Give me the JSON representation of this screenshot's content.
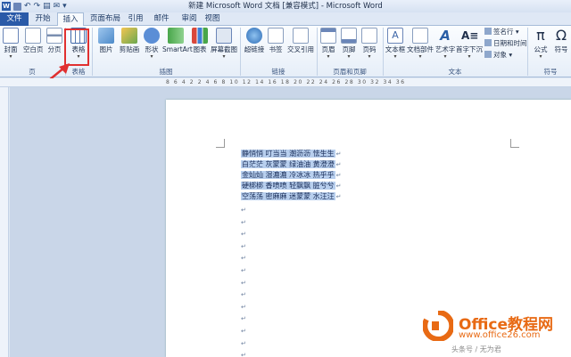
{
  "window": {
    "title": "新建 Microsoft Word 文档 [兼容模式] - Microsoft Word",
    "qat_icons": [
      "word-icon",
      "save-icon",
      "undo-icon",
      "redo-icon",
      "print-preview-icon",
      "email-icon",
      "customize-icon"
    ]
  },
  "tabs": {
    "file": "文件",
    "home": "开始",
    "insert": "插入",
    "layout": "页面布局",
    "references": "引用",
    "mailings": "邮件",
    "review": "审阅",
    "view": "视图"
  },
  "ribbon": {
    "pages": {
      "cover": "封面",
      "blank": "空白页",
      "break": "分页",
      "label": "页"
    },
    "tables": {
      "table": "表格",
      "label": "表格"
    },
    "illustrations": {
      "picture": "图片",
      "clipart": "剪贴画",
      "shapes": "形状",
      "smartart": "SmartArt",
      "chart": "图表",
      "screenshot": "屏幕截图",
      "label": "插图"
    },
    "links": {
      "hyperlink": "超链接",
      "bookmark": "书签",
      "crossref": "交叉引用",
      "label": "链接"
    },
    "header_footer": {
      "header": "页眉",
      "footer": "页脚",
      "page_number": "页码",
      "label": "页眉和页脚"
    },
    "text": {
      "textbox": "文本框",
      "quickparts": "文档部件",
      "wordart": "艺术字",
      "dropcap": "首字下沉",
      "signature": "签名行",
      "datetime": "日期和时间",
      "object": "对象",
      "label": "文本"
    },
    "symbols": {
      "equation": "公式",
      "symbol": "符号",
      "label": "符号"
    }
  },
  "ruler": {
    "numbers": "8 6 4 2 2 4 6 8 10 12 14 16 18 20 22 24 26 28 30 32 34 36"
  },
  "document": {
    "selected_lines": [
      "静悄悄 叮当当 潮沥沥 怯生生",
      "白茫茫 灰蒙蒙 绿油油 黄澄澄",
      "金灿灿 湿漉漉 冷冰冰 热乎乎",
      "硬梆梆 香喷喷 轻飘飘 脏兮兮",
      "空荡荡 密麻麻 迷蒙蒙 水汪汪"
    ],
    "paragraph_mark": "↵",
    "empty_paragraphs": 13
  },
  "watermark": {
    "title": "Office教程网",
    "url": "www.office26.com",
    "caption": "头条号 / 无为君"
  },
  "colors": {
    "accent": "#2a5aa8",
    "highlight_box": "#e03030",
    "selection": "#b8cfee",
    "logo": "#e86a14"
  }
}
